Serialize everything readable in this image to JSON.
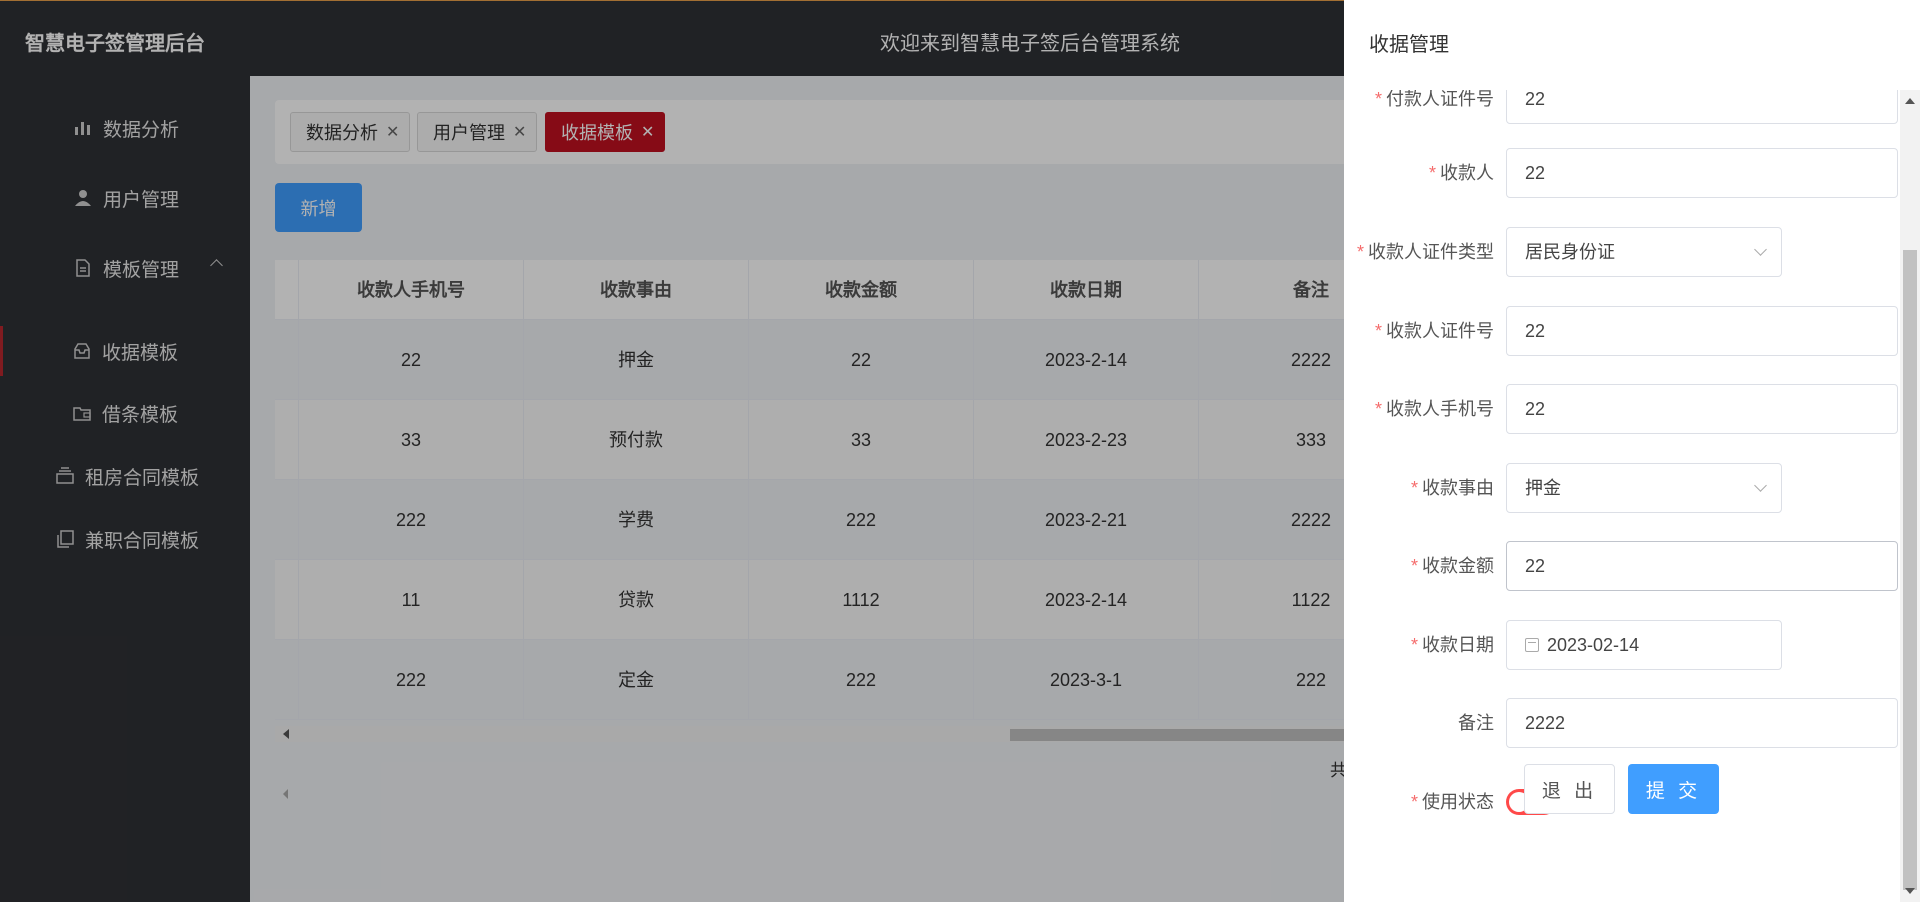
{
  "header": {
    "brand": "智慧电子签管理后台",
    "welcome": "欢迎来到智慧电子签后台管理系统"
  },
  "sidebar": {
    "items": [
      {
        "label": "数据分析",
        "icon": "bar-chart-icon"
      },
      {
        "label": "用户管理",
        "icon": "user-icon"
      },
      {
        "label": "模板管理",
        "icon": "document-icon"
      },
      {
        "label": "收据模板",
        "icon": "inbox-icon"
      },
      {
        "label": "借条模板",
        "icon": "folder-icon"
      },
      {
        "label": "租房合同模板",
        "icon": "stack-icon"
      },
      {
        "label": "兼职合同模板",
        "icon": "copy-icon"
      }
    ]
  },
  "tags": [
    {
      "label": "数据分析"
    },
    {
      "label": "用户管理"
    },
    {
      "label": "收据模板"
    }
  ],
  "add_button": "新增",
  "table": {
    "headers": [
      "收款人手机号",
      "收款事由",
      "收款金额",
      "收款日期",
      "备注"
    ],
    "rows": [
      [
        "22",
        "押金",
        "22",
        "2023-2-14",
        "2222"
      ],
      [
        "33",
        "预付款",
        "33",
        "2023-2-23",
        "333"
      ],
      [
        "222",
        "学费",
        "222",
        "2023-2-21",
        "2222"
      ],
      [
        "11",
        "贷款",
        "1112",
        "2023-2-14",
        "1122"
      ],
      [
        "222",
        "定金",
        "222",
        "2023-3-1",
        "222"
      ]
    ]
  },
  "pager_text": "共",
  "drawer": {
    "title": "收据管理",
    "fields": [
      {
        "label": "付款人证件号",
        "value": "22",
        "required": true
      },
      {
        "label": "收款人",
        "value": "22",
        "required": true
      },
      {
        "label": "收款人证件类型",
        "value": "居民身份证",
        "required": true
      },
      {
        "label": "收款人证件号",
        "value": "22",
        "required": true
      },
      {
        "label": "收款人手机号",
        "value": "22",
        "required": true
      },
      {
        "label": "收款事由",
        "value": "押金",
        "required": true
      },
      {
        "label": "收款金额",
        "value": "22",
        "required": true
      },
      {
        "label": "收款日期",
        "value": "2023-02-14",
        "required": true
      },
      {
        "label": "备注",
        "value": "2222",
        "required": false
      },
      {
        "label": "使用状态",
        "value": "off",
        "required": true
      }
    ],
    "exit_label": "退 出",
    "submit_label": "提 交"
  },
  "colors": {
    "header_bg": "#2f3135",
    "active_tag": "#c01020",
    "primary": "#409eff",
    "toggle_off": "#ff4949"
  }
}
